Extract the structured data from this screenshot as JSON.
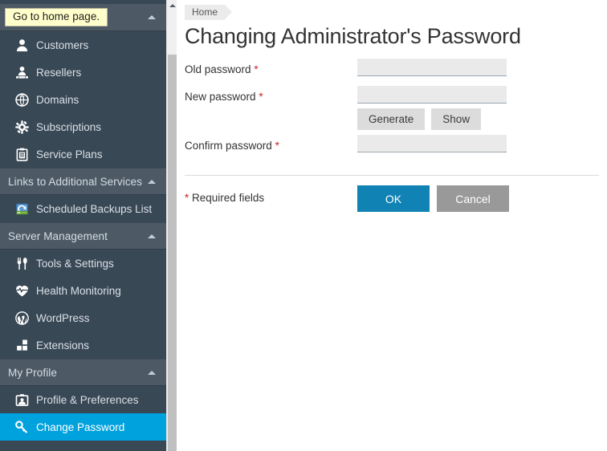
{
  "sidebar": {
    "home_tooltip": "Go to home page.",
    "sections": [
      {
        "type": "home",
        "label": "Go to home page."
      },
      {
        "type": "items",
        "items": [
          {
            "label": "Customers",
            "icon": "user-icon",
            "active": false
          },
          {
            "label": "Resellers",
            "icon": "reseller-icon",
            "active": false
          },
          {
            "label": "Domains",
            "icon": "globe-icon",
            "active": false
          },
          {
            "label": "Subscriptions",
            "icon": "gear-icon",
            "active": false
          },
          {
            "label": "Service Plans",
            "icon": "clipboard-icon",
            "active": false
          }
        ]
      },
      {
        "type": "group",
        "label": "Links to Additional Services",
        "items": [
          {
            "label": "Scheduled Backups List",
            "icon": "backup-icon",
            "active": false
          }
        ]
      },
      {
        "type": "group",
        "label": "Server Management",
        "items": [
          {
            "label": "Tools & Settings",
            "icon": "tools-icon",
            "active": false
          },
          {
            "label": "Health Monitoring",
            "icon": "heart-pulse-icon",
            "active": false
          },
          {
            "label": "WordPress",
            "icon": "wordpress-icon",
            "active": false
          },
          {
            "label": "Extensions",
            "icon": "extensions-icon",
            "active": false
          }
        ]
      },
      {
        "type": "group",
        "label": "My Profile",
        "items": [
          {
            "label": "Profile & Preferences",
            "icon": "profile-card-icon",
            "active": false
          },
          {
            "label": "Change Password",
            "icon": "key-icon",
            "active": true
          }
        ]
      }
    ]
  },
  "breadcrumb": {
    "items": [
      "Home"
    ]
  },
  "page": {
    "title": "Changing Administrator's Password"
  },
  "form": {
    "fields": [
      {
        "label": "Old password",
        "required_mark": "*",
        "value": "",
        "placeholder": ""
      },
      {
        "label": "New password",
        "required_mark": "*",
        "value": "",
        "placeholder": ""
      },
      {
        "label": "Confirm password",
        "required_mark": "*",
        "value": "",
        "placeholder": ""
      }
    ],
    "generate_label": "Generate",
    "show_label": "Show",
    "required_note_mark": "*",
    "required_note": "Required fields",
    "ok_label": "OK",
    "cancel_label": "Cancel"
  },
  "colors": {
    "sidebar_bg": "#394855",
    "sidebar_group_bg": "#4d5a66",
    "accent_active": "#00a2dd",
    "ok_button": "#1082b4",
    "cancel_button": "#999999",
    "required_star": "#cc2222",
    "tooltip_bg": "#ffffcc"
  }
}
